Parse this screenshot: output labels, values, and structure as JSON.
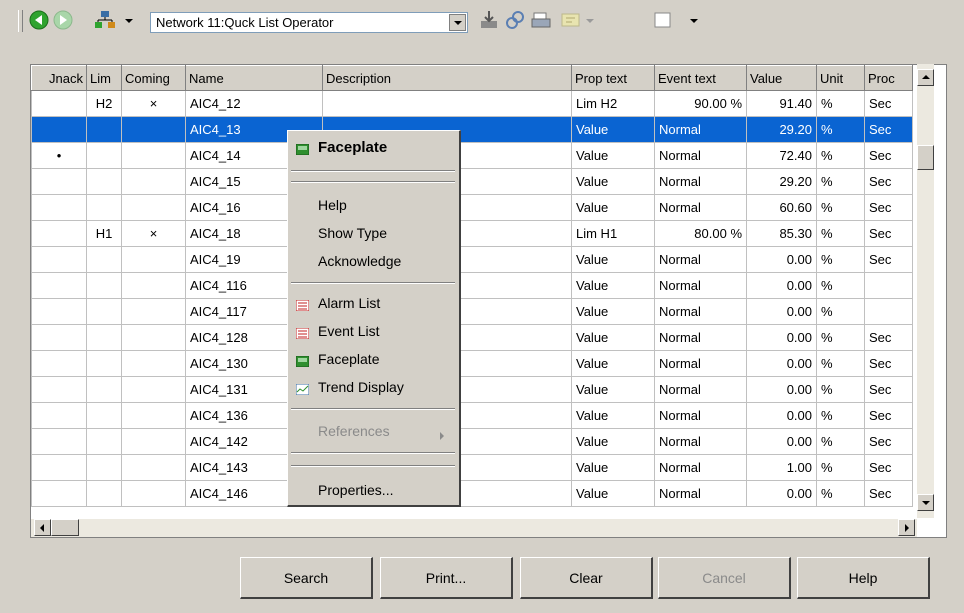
{
  "toolbar": {
    "network_select": "Network 11:Quck List Operator",
    "icons": [
      "back-arrow-icon",
      "forward-arrow-icon",
      "tree-icon",
      "download-icon",
      "link-icon",
      "print-icon",
      "filter-icon",
      "window-icon"
    ]
  },
  "table": {
    "columns": [
      "Jnack",
      "Lim",
      "Coming",
      "Name",
      "Description",
      "Prop text",
      "Event text",
      "Value",
      "Unit",
      "Proc"
    ],
    "rows": [
      [
        "",
        "H2",
        "×",
        "AIC4_12",
        "",
        "Lim H2",
        "90.00 %",
        "91.40",
        "%",
        "Sec"
      ],
      [
        "",
        "",
        "",
        "AIC4_13",
        "",
        "Value",
        "Normal",
        "29.20",
        "%",
        "Sec"
      ],
      [
        "•",
        "",
        "",
        "AIC4_14",
        "",
        "Value",
        "Normal",
        "72.40",
        "%",
        "Sec"
      ],
      [
        "",
        "",
        "",
        "AIC4_15",
        "",
        "Value",
        "Normal",
        "29.20",
        "%",
        "Sec"
      ],
      [
        "",
        "",
        "",
        "AIC4_16",
        "",
        "Value",
        "Normal",
        "60.60",
        "%",
        "Sec"
      ],
      [
        "",
        "H1",
        "×",
        "AIC4_18",
        "",
        "Lim H1",
        "80.00 %",
        "85.30",
        "%",
        "Sec"
      ],
      [
        "",
        "",
        "",
        "AIC4_19",
        "",
        "Value",
        "Normal",
        "0.00",
        "%",
        "Sec"
      ],
      [
        "",
        "",
        "",
        "AIC4_116",
        "",
        "Value",
        "Normal",
        "0.00",
        "%",
        ""
      ],
      [
        "",
        "",
        "",
        "AIC4_117",
        "",
        "Value",
        "Normal",
        "0.00",
        "%",
        ""
      ],
      [
        "",
        "",
        "",
        "AIC4_128",
        "",
        "Value",
        "Normal",
        "0.00",
        "%",
        "Sec"
      ],
      [
        "",
        "",
        "",
        "AIC4_130",
        "",
        "Value",
        "Normal",
        "0.00",
        "%",
        "Sec"
      ],
      [
        "",
        "",
        "",
        "AIC4_131",
        "",
        "Value",
        "Normal",
        "0.00",
        "%",
        "Sec"
      ],
      [
        "",
        "",
        "",
        "AIC4_136",
        "",
        "Value",
        "Normal",
        "0.00",
        "%",
        "Sec"
      ],
      [
        "",
        "",
        "",
        "AIC4_142",
        "",
        "Value",
        "Normal",
        "0.00",
        "%",
        "Sec"
      ],
      [
        "",
        "",
        "",
        "AIC4_143",
        "",
        "Value",
        "Normal",
        "1.00",
        "%",
        "Sec"
      ],
      [
        "",
        "",
        "",
        "AIC4_146",
        "",
        "Value",
        "Normal",
        "0.00",
        "%",
        "Sec"
      ]
    ],
    "selected_row": 1
  },
  "context_menu": {
    "faceplate_header": "Faceplate",
    "help": "Help",
    "show_type": "Show Type",
    "acknowledge": "Acknowledge",
    "alarm_list": "Alarm List",
    "event_list": "Event List",
    "faceplate": "Faceplate",
    "trend_display": "Trend Display",
    "references": "References",
    "properties": "Properties..."
  },
  "buttons": {
    "search": "Search",
    "print": "Print...",
    "clear": "Clear",
    "cancel": "Cancel",
    "help": "Help"
  },
  "colors": {
    "selection": "#0a64d2",
    "face": "#d4d0c8"
  }
}
